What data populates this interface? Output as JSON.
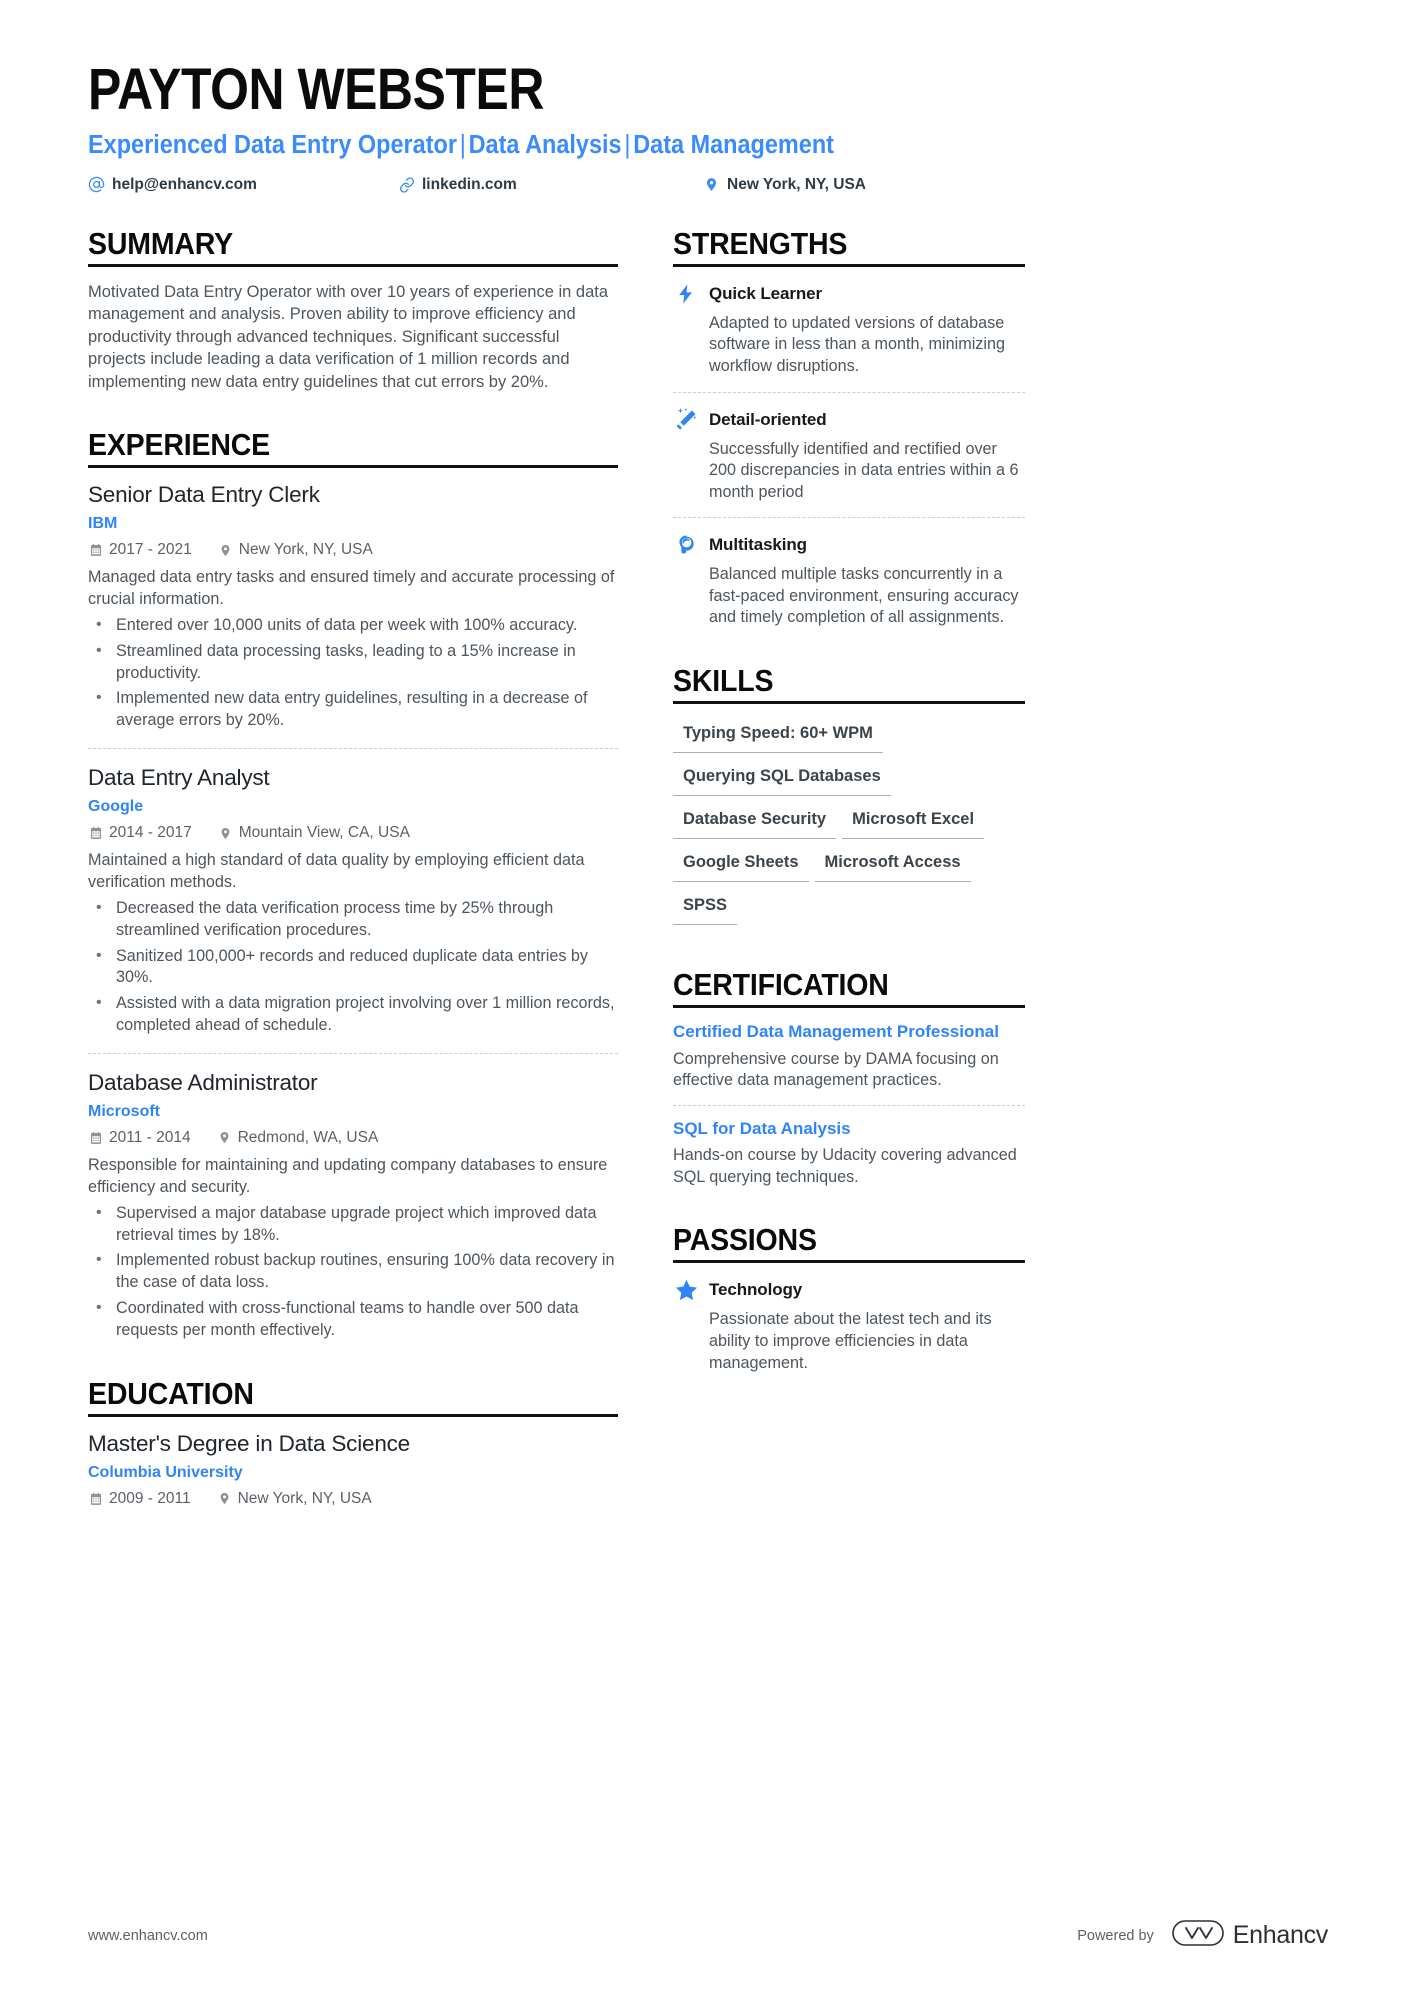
{
  "header": {
    "name": "PAYTON WEBSTER",
    "headline_parts": [
      "Experienced Data Entry Operator",
      "Data Analysis",
      "Data Management"
    ],
    "headline_separator": "|",
    "contacts": [
      {
        "icon": "at-sign-icon",
        "text": "help@enhancv.com"
      },
      {
        "icon": "link-icon",
        "text": "linkedin.com"
      },
      {
        "icon": "location-pin-icon",
        "text": "New York, NY, USA"
      }
    ]
  },
  "summary": {
    "heading": "SUMMARY",
    "text": "Motivated Data Entry Operator with over 10 years of experience in data management and analysis. Proven ability to improve efficiency and productivity through advanced techniques. Significant successful projects include leading a data verification of 1 million records and implementing new data entry guidelines that cut errors by 20%."
  },
  "experience": {
    "heading": "EXPERIENCE",
    "jobs": [
      {
        "title": "Senior Data Entry Clerk",
        "company": "IBM",
        "dates": "2017 - 2021",
        "location": "New York, NY, USA",
        "description": "Managed data entry tasks and ensured timely and accurate processing of crucial information.",
        "bullets": [
          "Entered over 10,000 units of data per week with 100% accuracy.",
          "Streamlined data processing tasks, leading to a 15% increase in productivity.",
          "Implemented new data entry guidelines, resulting in a decrease of average errors by 20%."
        ]
      },
      {
        "title": "Data Entry Analyst",
        "company": "Google",
        "dates": "2014 - 2017",
        "location": "Mountain View, CA, USA",
        "description": "Maintained a high standard of data quality by employing efficient data verification methods.",
        "bullets": [
          "Decreased the data verification process time by 25% through streamlined verification procedures.",
          "Sanitized 100,000+ records and reduced duplicate data entries by 30%.",
          "Assisted with a data migration project involving over 1 million records, completed ahead of schedule."
        ]
      },
      {
        "title": "Database Administrator",
        "company": "Microsoft",
        "dates": "2011 - 2014",
        "location": "Redmond, WA, USA",
        "description": "Responsible for maintaining and updating company databases to ensure efficiency and security.",
        "bullets": [
          "Supervised a major database upgrade project which improved data retrieval times by 18%.",
          "Implemented robust backup routines, ensuring 100% data recovery in the case of data loss.",
          "Coordinated with cross-functional teams to handle over 500 data requests per month effectively."
        ]
      }
    ]
  },
  "education": {
    "heading": "EDUCATION",
    "entries": [
      {
        "degree": "Master's Degree in Data Science",
        "school": "Columbia University",
        "dates": "2009 - 2011",
        "location": "New York, NY, USA"
      }
    ]
  },
  "strengths": {
    "heading": "STRENGTHS",
    "items": [
      {
        "icon": "lightning-bolt-icon",
        "title": "Quick Learner",
        "text": "Adapted to updated versions of database software in less than a month, minimizing workflow disruptions."
      },
      {
        "icon": "magic-wand-icon",
        "title": "Detail-oriented",
        "text": "Successfully identified and rectified over 200 discrepancies in data entries within a 6 month period"
      },
      {
        "icon": "head-profile-icon",
        "title": "Multitasking",
        "text": "Balanced multiple tasks concurrently in a fast-paced environment, ensuring accuracy and timely completion of all assignments."
      }
    ]
  },
  "skills": {
    "heading": "SKILLS",
    "items": [
      "Typing Speed: 60+ WPM",
      "Querying SQL Databases",
      "Database Security",
      "Microsoft Excel",
      "Google Sheets",
      "Microsoft Access",
      "SPSS"
    ]
  },
  "certification": {
    "heading": "CERTIFICATION",
    "items": [
      {
        "title": "Certified Data Management Professional",
        "description": "Comprehensive course by DAMA focusing on effective data management practices."
      },
      {
        "title": "SQL for Data Analysis",
        "description": "Hands-on course by Udacity covering advanced SQL querying techniques."
      }
    ]
  },
  "passions": {
    "heading": "PASSIONS",
    "items": [
      {
        "icon": "star-icon",
        "title": "Technology",
        "text": "Passionate about the latest tech and its ability to improve efficiencies in data management."
      }
    ]
  },
  "footer": {
    "url": "www.enhancv.com",
    "powered_by": "Powered by",
    "brand": "Enhancv",
    "brand_mark": "enhancv-logo-icon"
  },
  "colors": {
    "accent": "#2f85f5",
    "headline": "#3a8bfd",
    "body_text": "#4d555d",
    "heading_text": "#0b0b0b"
  }
}
